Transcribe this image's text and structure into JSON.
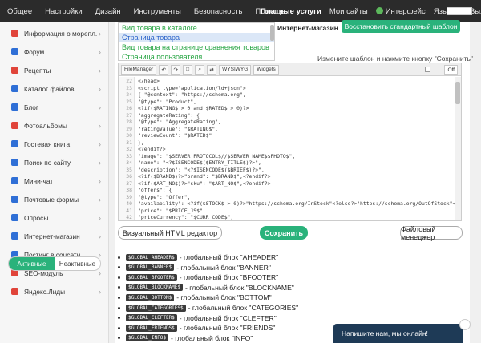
{
  "topbar": {
    "items": [
      "Общее",
      "Настройки",
      "Дизайн",
      "Инструменты",
      "Безопасность",
      "Помощь"
    ],
    "paid": "Платные услуги",
    "site": "Мои сайты",
    "interfaces": "Интерфейс",
    "lang": "Язык",
    "logout": "Выход"
  },
  "sidebar": {
    "items": [
      {
        "label": "Информация о морепл...",
        "color": "#e0443a"
      },
      {
        "label": "Форум",
        "color": "#2f6fd6"
      },
      {
        "label": "Рецепты",
        "color": "#e0443a"
      },
      {
        "label": "Каталог файлов",
        "color": "#2f6fd6"
      },
      {
        "label": "Блог",
        "color": "#2f6fd6"
      },
      {
        "label": "Фотоальбомы",
        "color": "#e0443a"
      },
      {
        "label": "Гостевая книга",
        "color": "#2f6fd6"
      },
      {
        "label": "Поиск по сайту",
        "color": "#2f6fd6"
      },
      {
        "label": "Мини-чат",
        "color": "#2f6fd6"
      },
      {
        "label": "Почтовые формы",
        "color": "#2f6fd6"
      },
      {
        "label": "Опросы",
        "color": "#2f6fd6"
      },
      {
        "label": "Интернет-магазин",
        "color": "#2f6fd6"
      },
      {
        "label": "Постинг в соцсети",
        "color": "#2f6fd6"
      },
      {
        "label": "SEO-модуль",
        "color": "#e0443a"
      },
      {
        "label": "Яндекс.Лиды",
        "color": "#e0443a"
      }
    ],
    "toggle_on": "Активные",
    "toggle_off": "Неактивные"
  },
  "main": {
    "templates": [
      "Вид товара в каталоге",
      "Страница товара",
      "Вид товара на странице сравнения товаров",
      "Страница пользователя"
    ],
    "site_label": "Интернет-магазин",
    "restore_btn": "Восстановить стандартный шаблон",
    "hint": "Измените шаблон и нажмите кнопку \"Сохранить\"",
    "toolbar": {
      "filemanager": "FileManager",
      "wysiwyg": "WYSIWYG",
      "widgets": "Widgets",
      "off": "Off"
    },
    "code": [
      {
        "n": "22",
        "t": "</head>"
      },
      {
        "n": "23",
        "t": "<script type=\"application/ld+json\">"
      },
      {
        "n": "24",
        "t": "{ \"@context\": \"https://schema.org\","
      },
      {
        "n": "25",
        "t": "\"@type\": \"Product\","
      },
      {
        "n": "26",
        "t": "<?if($RATING$ > 0 and $RATED$ > 0)?>"
      },
      {
        "n": "27",
        "t": "\"aggregateRating\": {"
      },
      {
        "n": "28",
        "t": "\"@type\": \"AggregateRating\","
      },
      {
        "n": "29",
        "t": "\"ratingValue\": \"$RATING$\","
      },
      {
        "n": "30",
        "t": "\"reviewCount\": \"$RATED$\""
      },
      {
        "n": "31",
        "t": "},"
      },
      {
        "n": "32",
        "t": "<?endif?>"
      },
      {
        "n": "33",
        "t": "\"image\": \"$SERVER_PROTOCOL$//$SERVER_NAME$$PHOTO$\","
      },
      {
        "n": "34",
        "t": "\"name\": \"<?$ISENCODE$($ENTRY_TITLE$)?>\","
      },
      {
        "n": "35",
        "t": "\"description\": \"<?$ISENCODE$($BRIEF$)?>\","
      },
      {
        "n": "36",
        "t": "<?if($BRAND$)?>\"brand\": \"$BRAND$\",<?endif?>"
      },
      {
        "n": "37",
        "t": "<?if($ART_NO$)?>\"sku\": \"$ART_NO$\",<?endif?>"
      },
      {
        "n": "38",
        "t": "\"offers\": {"
      },
      {
        "n": "39",
        "t": "\"@type\": \"Offer\","
      },
      {
        "n": "40",
        "t": "\"availability\": <?if($STOCK$ > 0)?>\"https://schema.org/InStock\"<?else?>\"https://schema.org/OutOfStock\"<?endif?>,"
      },
      {
        "n": "41",
        "t": "\"price\": \"$PRICE_JS$\","
      },
      {
        "n": "42",
        "t": "\"priceCurrency\": \"$CURR_CODE$\","
      },
      {
        "n": "43",
        "t": "\"url\": \"$ENTRY_LINK$\""
      }
    ],
    "btn_visual": "Визуальный HTML редактор",
    "btn_save": "Сохранить",
    "btn_filemanager": "Файловый менеджер",
    "globals": [
      {
        "code": "$GLOBAL_AHEADER$",
        "desc": "- глобальный блок \"AHEADER\""
      },
      {
        "code": "$GLOBAL_BANNER$",
        "desc": "- глобальный блок \"BANNER\""
      },
      {
        "code": "$GLOBAL_BFOOTER$",
        "desc": "- глобальный блок \"BFOOTER\""
      },
      {
        "code": "$GLOBAL_BLOCKNAME$",
        "desc": "- глобальный блок \"BLOCKNAME\""
      },
      {
        "code": "$GLOBAL_BOTTOM$",
        "desc": "- глобальный блок \"BOTTOM\""
      },
      {
        "code": "$GLOBAL_CATEGORIES$",
        "desc": "- глобальный блок \"CATEGORIES\""
      },
      {
        "code": "$GLOBAL_CLEFTER$",
        "desc": "- глобальный блок \"CLEFTER\""
      },
      {
        "code": "$GLOBAL_FRIENDS$",
        "desc": "- глобальный блок \"FRIENDS\""
      },
      {
        "code": "$GLOBAL_INFO$",
        "desc": "- глобальный блок \"INFO\""
      }
    ]
  },
  "chat": "Напишите нам, мы онлайн!"
}
